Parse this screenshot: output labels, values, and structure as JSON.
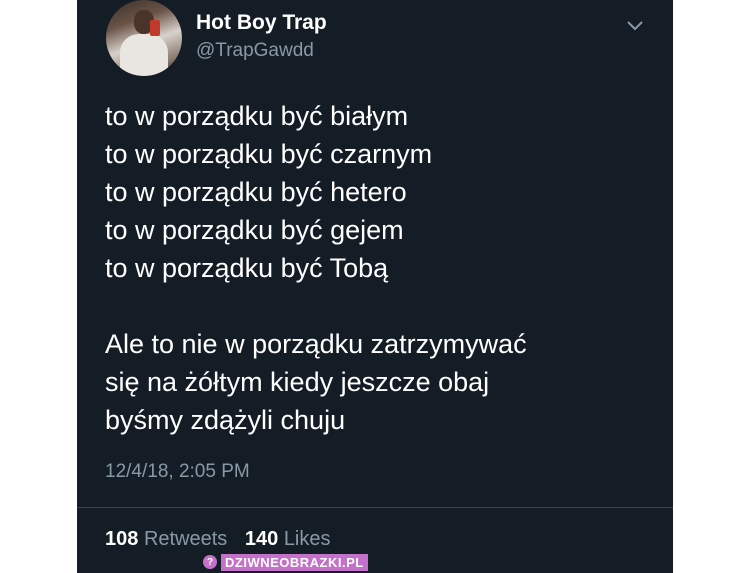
{
  "tweet": {
    "author": {
      "name": "Hot Boy Trap",
      "handle": "@TrapGawdd"
    },
    "text_lines": [
      "to w porządku być białym",
      "to w porządku być czarnym",
      "to w porządku być hetero",
      "to w porządku być gejem",
      "to w porządku być Tobą"
    ],
    "text_lines_2": [
      "Ale to nie w porządku zatrzymywać",
      "się na żółtym kiedy jeszcze obaj",
      "byśmy zdążyli chuju"
    ],
    "timestamp": "12/4/18, 2:05 PM",
    "stats": {
      "retweets_count": "108",
      "retweets_label": "Retweets",
      "likes_count": "140",
      "likes_label": "Likes"
    }
  },
  "watermark": {
    "text": "DZIWNEOBRAZKI.PL"
  },
  "colors": {
    "background": "#141d26",
    "text_primary": "#ffffff",
    "text_secondary": "#8899a6",
    "watermark": "#c471c9"
  },
  "icons": {
    "menu": "chevron-down-icon",
    "avatar": "avatar"
  }
}
